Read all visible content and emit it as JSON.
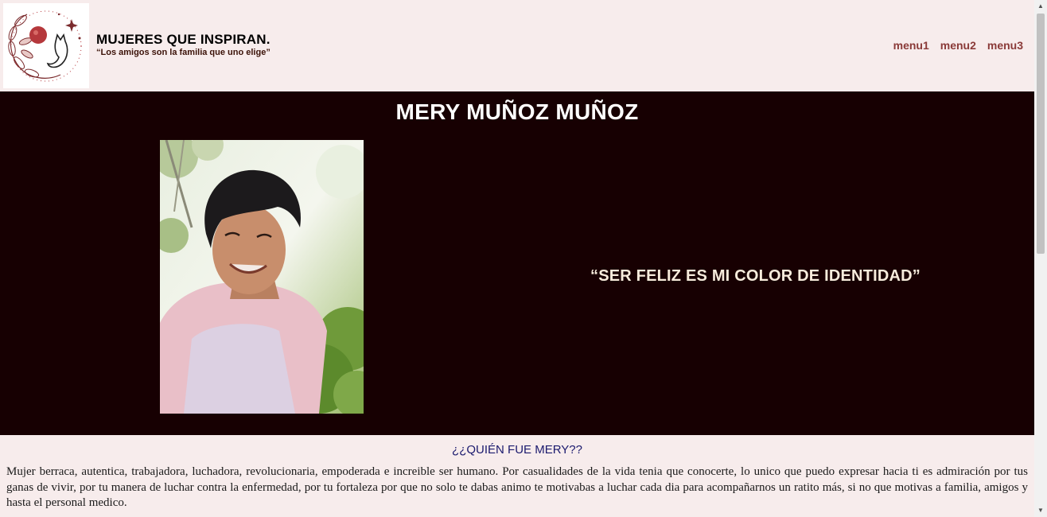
{
  "header": {
    "title": "MUJERES QUE INSPIRAN.",
    "subtitle": "“Los amigos son la familia que uno elige”",
    "logo_icon": "floral-wreath-logo-icon",
    "nav": [
      "menu1",
      "menu2",
      "menu3"
    ]
  },
  "hero": {
    "name": "MERY MUÑOZ MUÑOZ",
    "quote": "“SER FELIZ ES MI COLOR DE IDENTIDAD”",
    "photo_icon": "portrait-photo"
  },
  "about": {
    "heading": "¿¿QUIÉN FUE MERY??",
    "text": "Mujer berraca, autentica, trabajadora, luchadora, revolucionaria, empoderada e increible ser humano. Por casualidades de la vida tenia que conocerte, lo unico que puedo expresar hacia ti es admiración por tus ganas de vivir, por tu manera de luchar contra la enfermedad, por tu fortaleza por que no solo te dabas animo te motivabas a luchar cada dia para acompañarnos un ratito más, si no que motivas a familia, amigos y hasta el personal medico."
  },
  "colors": {
    "page_bg": "#f7ecec",
    "hero_bg": "#170002",
    "nav_link": "#8a3a38",
    "quote": "#f7ecdc",
    "heading_blue": "#1b1a6e"
  }
}
